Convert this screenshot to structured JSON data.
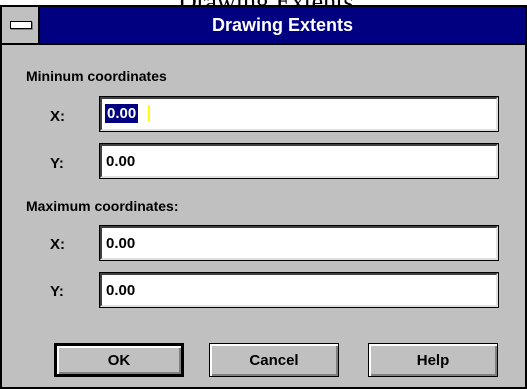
{
  "background_text": "Drawing Extents",
  "window": {
    "title": "Drawing Extents",
    "system_menu_icon": "system-menu-icon"
  },
  "minimum": {
    "label": "Mininum coordinates",
    "x_label": "X:",
    "x_value": "0.00",
    "y_label": "Y:",
    "y_value": "0.00"
  },
  "maximum": {
    "label": "Maximum coordinates:",
    "x_label": "X:",
    "x_value": "0.00",
    "y_label": "Y:",
    "y_value": "0.00"
  },
  "buttons": {
    "ok": "OK",
    "cancel": "Cancel",
    "help": "Help"
  },
  "colors": {
    "title_bar": "#000080",
    "dialog_face": "#c0c0c0",
    "selection": "#000080",
    "caret": "#ffff00"
  }
}
